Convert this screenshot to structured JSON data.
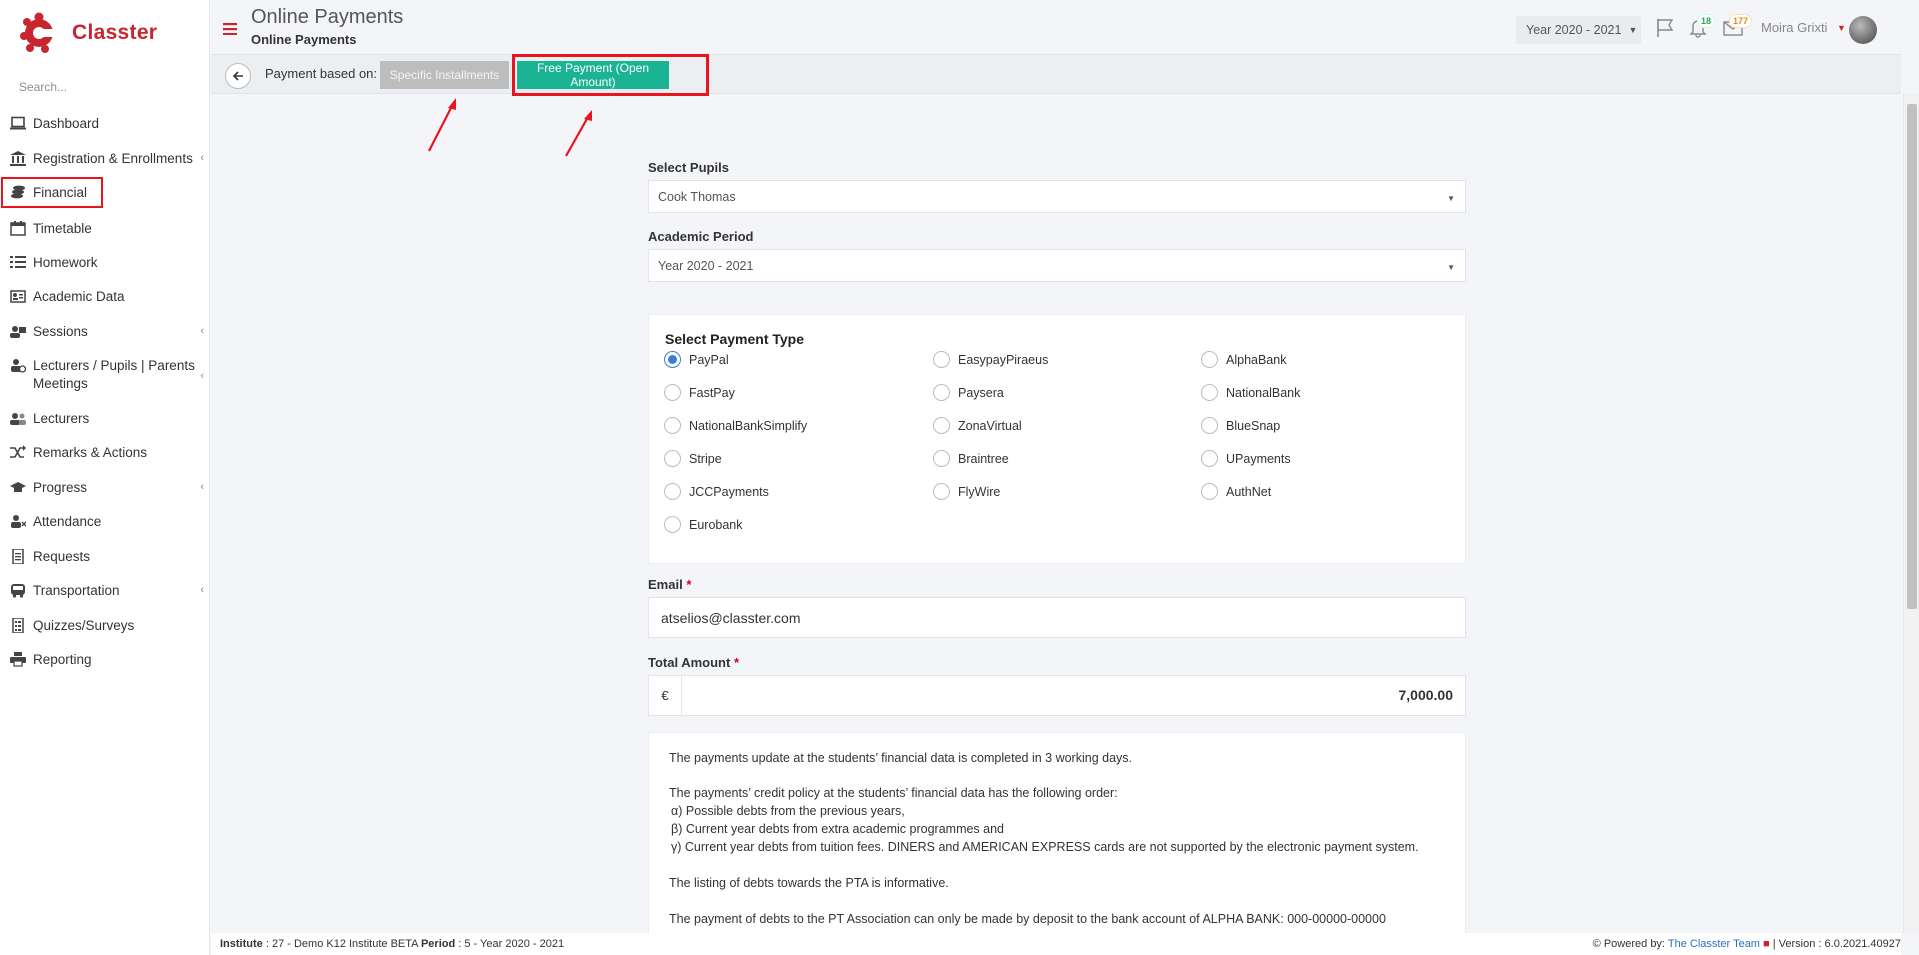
{
  "app": {
    "name": "Classter"
  },
  "sidebar": {
    "search_placeholder": "Search...",
    "items": [
      {
        "label": "Dashboard",
        "icon": "laptop-icon",
        "has_submenu": false
      },
      {
        "label": "Registration & Enrollments",
        "icon": "bank-icon",
        "has_submenu": true
      },
      {
        "label": "Financial",
        "icon": "coins-icon",
        "has_submenu": false
      },
      {
        "label": "Timetable",
        "icon": "calendar-icon",
        "has_submenu": false
      },
      {
        "label": "Homework",
        "icon": "tasks-icon",
        "has_submenu": false
      },
      {
        "label": "Academic Data",
        "icon": "id-card-icon",
        "has_submenu": false
      },
      {
        "label": "Sessions",
        "icon": "group-icon",
        "has_submenu": true
      },
      {
        "label": "Lecturers / Pupils | Parents Meetings",
        "icon": "user-clock-icon",
        "has_submenu": true
      },
      {
        "label": "Lecturers",
        "icon": "users-icon",
        "has_submenu": false
      },
      {
        "label": "Remarks & Actions",
        "icon": "shuffle-icon",
        "has_submenu": false
      },
      {
        "label": "Progress",
        "icon": "graduation-cap-icon",
        "has_submenu": true
      },
      {
        "label": "Attendance",
        "icon": "user-x-icon",
        "has_submenu": false
      },
      {
        "label": "Requests",
        "icon": "document-icon",
        "has_submenu": false
      },
      {
        "label": "Transportation",
        "icon": "bus-icon",
        "has_submenu": true
      },
      {
        "label": "Quizzes/Surveys",
        "icon": "list-icon",
        "has_submenu": false
      },
      {
        "label": "Reporting",
        "icon": "printer-icon",
        "has_submenu": false
      }
    ]
  },
  "header": {
    "title": "Online Payments",
    "subtitle": "Online Payments",
    "year": "Year 2020 - 2021",
    "notifications_count": "18",
    "messages_count": "177",
    "user_name": "Moira Grixti"
  },
  "actionbar": {
    "label": "Payment based on:",
    "installments_label": "Specific Installments",
    "free_label": "Free Payment (Open Amount)"
  },
  "form": {
    "pupils_label": "Select Pupils",
    "pupils_value": "Cook Thomas",
    "period_label": "Academic Period",
    "period_value": "Year 2020 - 2021",
    "payment_type_title": "Select Payment Type",
    "payment_types": [
      {
        "label": "PayPal",
        "checked": true
      },
      {
        "label": "EasypayPiraeus",
        "checked": false
      },
      {
        "label": "AlphaBank",
        "checked": false
      },
      {
        "label": "FastPay",
        "checked": false
      },
      {
        "label": "Paysera",
        "checked": false
      },
      {
        "label": "NationalBank",
        "checked": false
      },
      {
        "label": "NationalBankSimplify",
        "checked": false
      },
      {
        "label": "ZonaVirtual",
        "checked": false
      },
      {
        "label": "BlueSnap",
        "checked": false
      },
      {
        "label": "Stripe",
        "checked": false
      },
      {
        "label": "Braintree",
        "checked": false
      },
      {
        "label": "UPayments",
        "checked": false
      },
      {
        "label": "JCCPayments",
        "checked": false
      },
      {
        "label": "FlyWire",
        "checked": false
      },
      {
        "label": "AuthNet",
        "checked": false
      },
      {
        "label": "Eurobank",
        "checked": false
      }
    ],
    "email_label": "Email",
    "email_value": "atselios@classter.com",
    "amount_label": "Total Amount",
    "currency": "€",
    "amount_value": "7,000.00",
    "required_mark": "*"
  },
  "info": {
    "lines": [
      "The payments update at the students’ financial data is completed in 3 working days.",
      "The payments’ credit policy at the students’ financial data has the following order:",
      "α) Possible debts from the previous years,",
      "β) Current year debts from extra academic programmes and",
      "γ) Current year debts from tuition fees. DINERS and AMERICAN EXPRESS cards are not supported by the electronic payment system.",
      "The listing of debts towards the PTA is informative.",
      "The payment of debts to the PT Association can only be made by deposit to the bank account of ALPHA BANK: 000-00000-00000"
    ]
  },
  "footer": {
    "institute_label": "Institute",
    "institute_value": ": 27 - Demo K12 Institute BETA",
    "period_label": "Period",
    "period_value": ": 5 - Year 2020 - 2021",
    "powered_label": "Powered by:",
    "powered_link": "The Classter Team",
    "version": "| Version : 6.0.2021.40927"
  },
  "colors": {
    "brand": "#c8262f",
    "accent_green": "#1ab394",
    "highlight_red": "#e8151e",
    "radio_blue": "#3a7ed8"
  }
}
